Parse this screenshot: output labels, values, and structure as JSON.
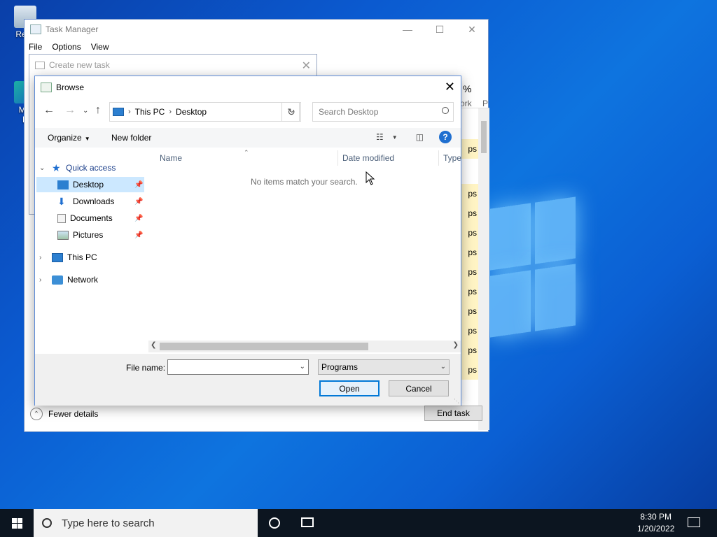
{
  "desktop": {
    "icons": [
      {
        "label": "Recy",
        "icon": "recycle-bin-icon"
      },
      {
        "label": "Mic\nE",
        "icon": "edge-icon"
      }
    ]
  },
  "task_manager": {
    "title": "Task Manager",
    "menu": [
      "File",
      "Options",
      "View"
    ],
    "column_fragments": [
      "%",
      "ork",
      "P"
    ],
    "row_fragment": "ps",
    "fewer_details": "Fewer details",
    "end_task": "End task"
  },
  "create_new_task": {
    "title": "Create new task"
  },
  "browse": {
    "title": "Browse",
    "breadcrumb": [
      "This PC",
      "Desktop"
    ],
    "search_placeholder": "Search Desktop",
    "toolbar": {
      "organize": "Organize",
      "new_folder": "New folder"
    },
    "nav": {
      "quick_access": "Quick access",
      "items": [
        "Desktop",
        "Downloads",
        "Documents",
        "Pictures"
      ],
      "this_pc": "This PC",
      "network": "Network"
    },
    "columns": [
      "Name",
      "Date modified",
      "Type"
    ],
    "empty_message": "No items match your search.",
    "file_name_label": "File name:",
    "file_name_value": "",
    "file_type": "Programs",
    "open": "Open",
    "cancel": "Cancel"
  },
  "taskbar": {
    "search_placeholder": "Type here to search",
    "time": "8:30 PM",
    "date": "1/20/2022"
  },
  "colors": {
    "selection": "#cce8ff",
    "accent": "#0078d7",
    "taskbar": "#0c1520"
  }
}
